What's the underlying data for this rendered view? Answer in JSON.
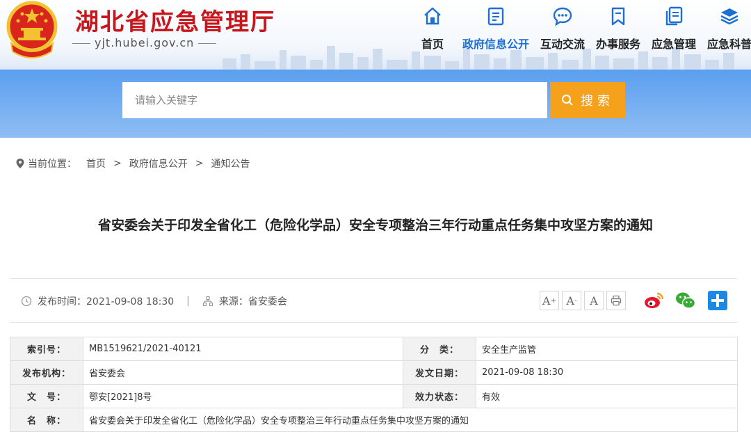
{
  "header": {
    "site_title": "湖北省应急管理厅",
    "site_domain": "yjt.hubei.gov.cn"
  },
  "nav": [
    {
      "label": "首页",
      "icon": "home-icon"
    },
    {
      "label": "政府信息公开",
      "icon": "document-icon",
      "active": true
    },
    {
      "label": "互动交流",
      "icon": "chat-icon"
    },
    {
      "label": "办事服务",
      "icon": "bookmark-icon"
    },
    {
      "label": "应急管理",
      "icon": "files-icon"
    },
    {
      "label": "应急科普",
      "icon": "layers-icon"
    }
  ],
  "search": {
    "placeholder": "请输入关键字",
    "button_label": "搜索"
  },
  "breadcrumb": {
    "prefix": "当前位置：",
    "items": [
      "首页",
      "政府信息公开",
      "通知公告"
    ],
    "separator": ">"
  },
  "article": {
    "title": "省安委会关于印发全省化工（危险化学品）安全专项整治三年行动重点任务集中攻坚方案的通知",
    "publish_time": "发布时间：2021-09-08 18:30",
    "source": "来源：省安委会",
    "divider": "|"
  },
  "font_tools": {
    "increase": "A",
    "increase_sup": "+",
    "decrease": "A",
    "decrease_sup": "-",
    "normal": "A"
  },
  "info": {
    "index_no_label": "索引号：",
    "index_no": "MB1519621/2021-40121",
    "category_label": "分　类：",
    "category": "安全生产监管",
    "issuer_label": "发布机构：",
    "issuer": "省安委会",
    "issue_date_label": "发文日期：",
    "issue_date": "2021-09-08 18:30",
    "doc_no_label": "文　号：",
    "doc_no": "鄂安[2021]8号",
    "status_label": "效力状态：",
    "status": "有效",
    "name_label": "名　称：",
    "name": "省安委会关于印发全省化工（危险化学品）安全专项整治三年行动重点任务集中攻坚方案的通知"
  },
  "colors": {
    "brand_red": "#c8161d",
    "nav_blue": "#1d6fd3",
    "search_orange": "#f5a11b",
    "weibo": "#e6162d",
    "wechat": "#3aa935",
    "share_plus": "#1e88e5"
  }
}
